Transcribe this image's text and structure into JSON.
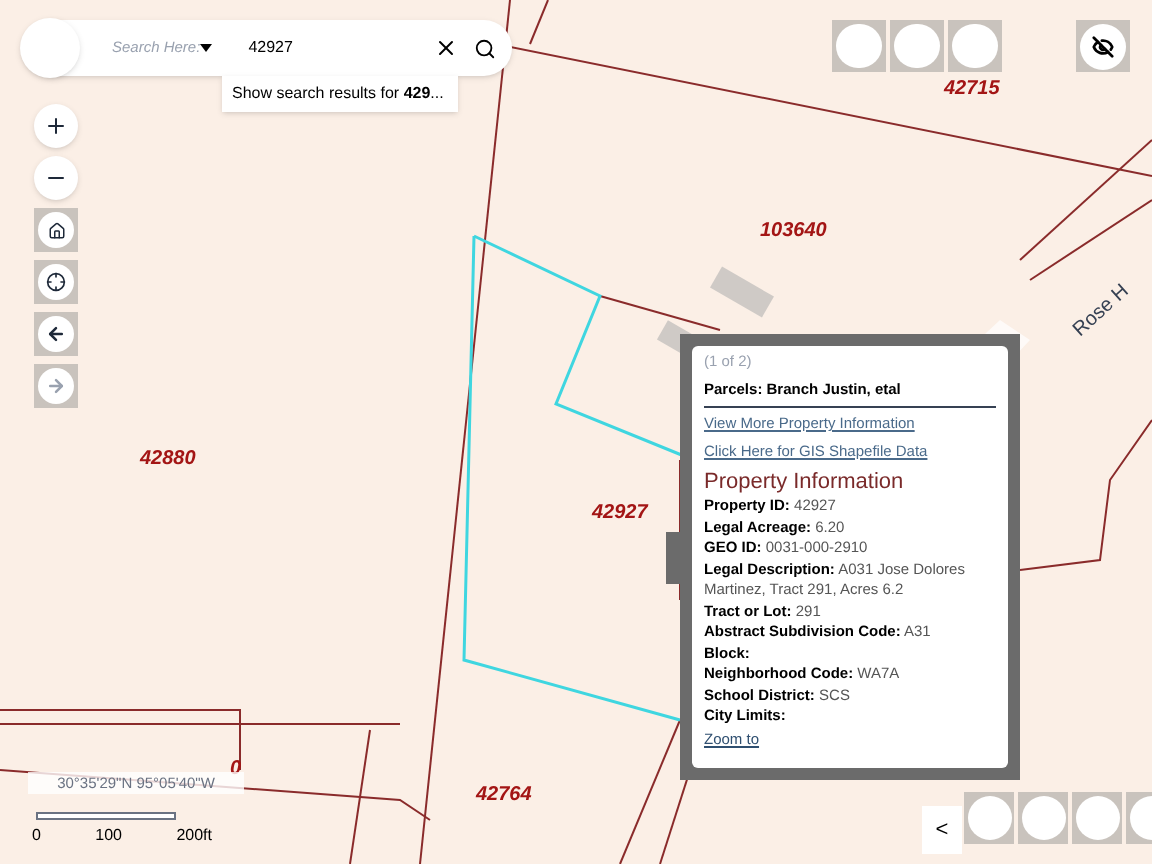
{
  "search": {
    "label": "Search Here:",
    "value": "42927",
    "suggestion": "Show search results for **429**..."
  },
  "map_labels": [
    {
      "text": "42715"
    },
    {
      "text": "103640"
    },
    {
      "text": "42880"
    },
    {
      "text": "42927"
    },
    {
      "text": "42764"
    },
    {
      "text": "0"
    }
  ],
  "road_label": "Rose H",
  "popup": {
    "counter": "(1 of 2)",
    "title": "Parcels: Branch Justin, etal",
    "links": [
      "View More Property Information",
      "Click Here for GIS Shapefile Data"
    ],
    "heading": "Property Information",
    "fields": [
      {
        "label": "Property ID:",
        "value": "42927"
      },
      {
        "label": "Legal Acreage:",
        "value": "6.20"
      },
      {
        "label": "GEO ID:",
        "value": "0031-000-2910"
      },
      {
        "label": "Legal Description:",
        "value": "A031 Jose Dolores Martinez, Tract 291, Acres 6.2"
      },
      {
        "label": "Tract or Lot:",
        "value": "291"
      },
      {
        "label": "Abstract Subdivision Code:",
        "value": "A31"
      },
      {
        "label": "Block:"
      },
      {
        "label": "Neighborhood Code:",
        "value": "WA7A"
      },
      {
        "label": "School District:",
        "value": "SCS"
      },
      {
        "label": "City Limits:"
      }
    ],
    "zoom_link": "Zoom to"
  },
  "coordinates": "30°35'29\"N 95°05'40\"W",
  "scale": [
    "0",
    "100",
    "200ft"
  ],
  "collapse_button": "<"
}
